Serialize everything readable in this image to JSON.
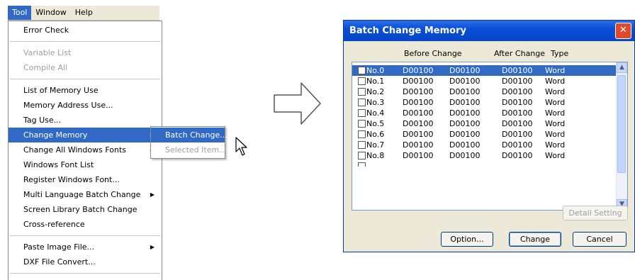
{
  "menubar": {
    "items": [
      "Tool",
      "Window",
      "Help"
    ]
  },
  "tool_menu": {
    "items": [
      {
        "label": "Error Check",
        "state": "normal"
      },
      {
        "label": "Variable List",
        "state": "disabled"
      },
      {
        "label": "Compile All",
        "state": "disabled"
      },
      {
        "label": "List of Memory Use",
        "state": "normal"
      },
      {
        "label": "Memory Address Use...",
        "state": "normal"
      },
      {
        "label": "Tag Use...",
        "state": "normal"
      },
      {
        "label": "Change Memory",
        "state": "selected"
      },
      {
        "label": "Change All Windows Fonts",
        "state": "normal"
      },
      {
        "label": "Windows Font List",
        "state": "normal"
      },
      {
        "label": "Register Windows Font...",
        "state": "normal"
      },
      {
        "label": "Multi Language Batch Change",
        "state": "normal"
      },
      {
        "label": "Screen Library Batch Change",
        "state": "normal"
      },
      {
        "label": "Cross-reference",
        "state": "normal"
      },
      {
        "label": "Paste Image File...",
        "state": "normal"
      },
      {
        "label": "DXF File Convert...",
        "state": "normal"
      }
    ],
    "submenu_arrow": "▶"
  },
  "submenu": {
    "items": [
      {
        "label": "Batch Change...",
        "state": "selected"
      },
      {
        "label": "Selected Item...",
        "state": "disabled"
      }
    ]
  },
  "dialog": {
    "title": "Batch Change Memory",
    "close_label": "✕",
    "columns": {
      "before": "Before Change",
      "after": "After Change",
      "type": "Type"
    },
    "rows": [
      {
        "no": "No.0",
        "before1": "D00100",
        "before2": "D00100",
        "after": "D00100",
        "type": "Word"
      },
      {
        "no": "No.1",
        "before1": "D00100",
        "before2": "D00100",
        "after": "D00100",
        "type": "Word"
      },
      {
        "no": "No.2",
        "before1": "D00100",
        "before2": "D00100",
        "after": "D00100",
        "type": "Word"
      },
      {
        "no": "No.3",
        "before1": "D00100",
        "before2": "D00100",
        "after": "D00100",
        "type": "Word"
      },
      {
        "no": "No.4",
        "before1": "D00100",
        "before2": "D00100",
        "after": "D00100",
        "type": "Word"
      },
      {
        "no": "No.5",
        "before1": "D00100",
        "before2": "D00100",
        "after": "D00100",
        "type": "Word"
      },
      {
        "no": "No.6",
        "before1": "D00100",
        "before2": "D00100",
        "after": "D00100",
        "type": "Word"
      },
      {
        "no": "No.7",
        "before1": "D00100",
        "before2": "D00100",
        "after": "D00100",
        "type": "Word"
      },
      {
        "no": "No.8",
        "before1": "D00100",
        "before2": "D00100",
        "after": "D00100",
        "type": "Word"
      }
    ],
    "buttons": {
      "detail": "Detail Setting",
      "option": "Option...",
      "change": "Change",
      "cancel": "Cancel"
    },
    "scroll_up": "▲",
    "scroll_down": "▼"
  },
  "colors": {
    "selection": "#316ac5",
    "titlebar": "#0a4fd6",
    "dialog_bg": "#ece9d8"
  }
}
